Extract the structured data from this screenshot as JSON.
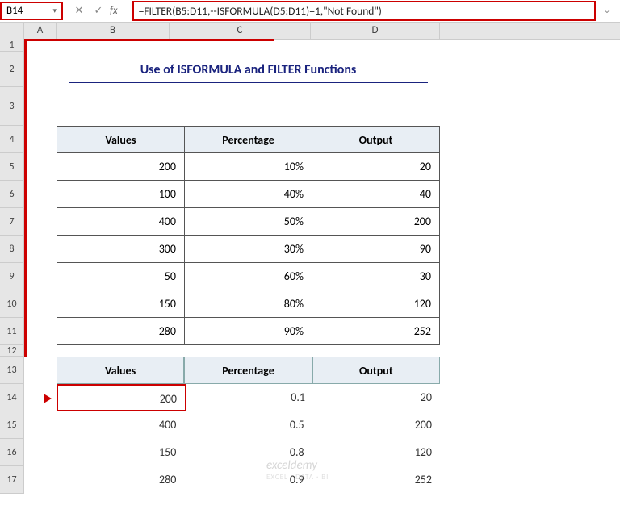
{
  "name_box": "B14",
  "formula": "=FILTER(B5:D11,--ISFORMULA(D5:D11)=1,\"Not Found\")",
  "fx_label": "fx",
  "columns": [
    "A",
    "B",
    "C",
    "D"
  ],
  "rows": [
    "1",
    "2",
    "3",
    "4",
    "5",
    "6",
    "7",
    "8",
    "9",
    "10",
    "11",
    "12",
    "13",
    "14",
    "15",
    "16",
    "17"
  ],
  "title": "Use of ISFORMULA and FILTER Functions",
  "table1": {
    "headers": [
      "Values",
      "Percentage",
      "Output"
    ],
    "rows": [
      {
        "values": "200",
        "percentage": "10%",
        "output": "20"
      },
      {
        "values": "100",
        "percentage": "40%",
        "output": "40"
      },
      {
        "values": "400",
        "percentage": "50%",
        "output": "200"
      },
      {
        "values": "300",
        "percentage": "30%",
        "output": "90"
      },
      {
        "values": "50",
        "percentage": "60%",
        "output": "30"
      },
      {
        "values": "150",
        "percentage": "80%",
        "output": "120"
      },
      {
        "values": "280",
        "percentage": "90%",
        "output": "252"
      }
    ]
  },
  "table2": {
    "headers": [
      "Values",
      "Percentage",
      "Output"
    ],
    "rows": [
      {
        "values": "200",
        "percentage": "0.1",
        "output": "20"
      },
      {
        "values": "400",
        "percentage": "0.5",
        "output": "200"
      },
      {
        "values": "150",
        "percentage": "0.8",
        "output": "120"
      },
      {
        "values": "280",
        "percentage": "0.9",
        "output": "252"
      }
    ]
  },
  "watermark": {
    "brand": "exceldemy",
    "sub": "EXCEL · DATA · BI"
  }
}
